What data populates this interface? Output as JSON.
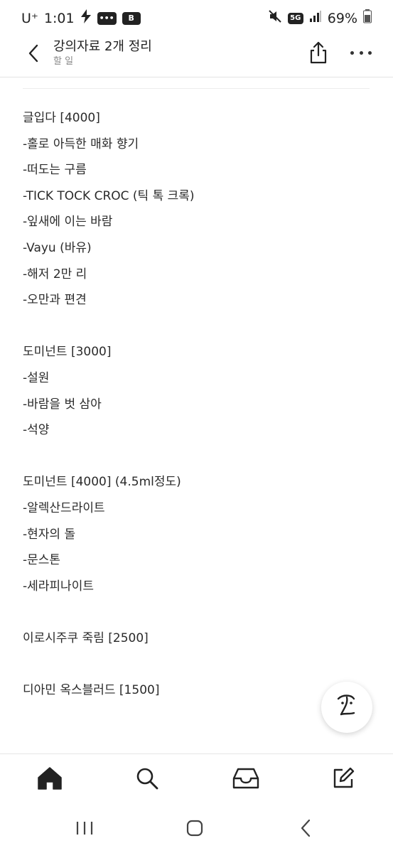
{
  "status_bar": {
    "carrier": "U⁺",
    "time": "1:01",
    "message_badge": "•••",
    "app_badge": "B",
    "network": "5G",
    "battery": "69%"
  },
  "header": {
    "title": "강의자료 2개 정리",
    "subtitle": "할 일"
  },
  "note": {
    "lines": [
      "글입다 [4000]",
      "-홀로 아득한 매화 향기",
      "-떠도는 구름",
      "-TICK TOCK CROC (틱 톡 크록)",
      "-잎새에 이는 바람",
      "-Vayu (바유)",
      "-해저 2만 리",
      "-오만과 편견",
      "",
      "도미넌트 [3000]",
      "-설원",
      "-바람을 벗 삼아",
      "-석양",
      "",
      "도미넌트 [4000] (4.5ml정도)",
      "-알렉산드라이트",
      "-현자의 돌",
      "-문스톤",
      "-세라피나이트",
      "",
      "이로시주쿠 죽림 [2500]",
      "",
      "디아민 옥스블러드 [1500]"
    ]
  },
  "icons": {
    "back": "chevron-left-icon",
    "share": "share-icon",
    "more": "more-horizontal-icon",
    "fab": "handwriting-icon",
    "nav": [
      "home-icon",
      "search-icon",
      "inbox-icon",
      "compose-icon"
    ],
    "system": [
      "recent-apps-icon",
      "home-circle-icon",
      "system-back-icon"
    ]
  }
}
